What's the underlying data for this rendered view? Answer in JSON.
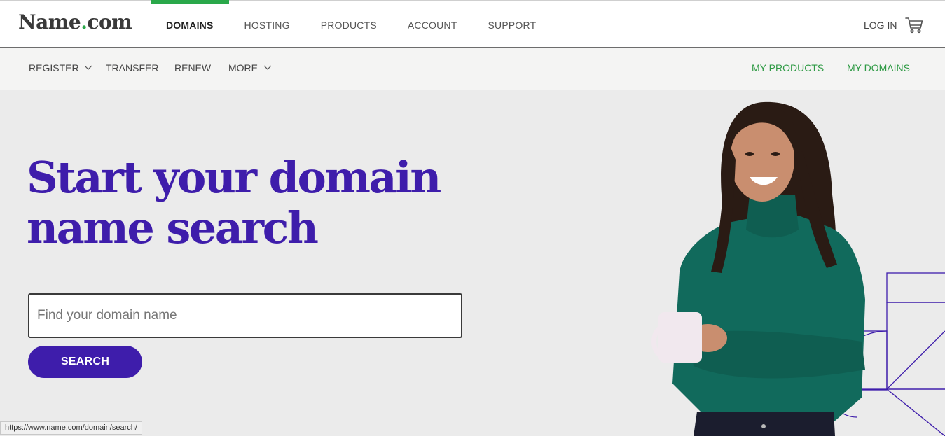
{
  "brand": {
    "name_part": "Name",
    "dot": ".",
    "tld_part": "com",
    "accent": "#2aa84a",
    "primary": "#3e1dab"
  },
  "main_nav": [
    {
      "label": "DOMAINS",
      "active": true
    },
    {
      "label": "HOSTING",
      "active": false
    },
    {
      "label": "PRODUCTS",
      "active": false
    },
    {
      "label": "ACCOUNT",
      "active": false
    },
    {
      "label": "SUPPORT",
      "active": false
    }
  ],
  "header_right": {
    "login_label": "LOG IN",
    "cart_icon": "cart-icon"
  },
  "sub_nav": {
    "left": [
      {
        "label": "REGISTER",
        "has_dropdown": true
      },
      {
        "label": "TRANSFER",
        "has_dropdown": false
      },
      {
        "label": "RENEW",
        "has_dropdown": false
      },
      {
        "label": "MORE",
        "has_dropdown": true
      }
    ],
    "right": [
      {
        "label": "MY PRODUCTS"
      },
      {
        "label": "MY DOMAINS"
      }
    ]
  },
  "hero": {
    "headline_line1": "Start your domain",
    "headline_line2": "name search",
    "search_placeholder": "Find your domain name",
    "search_value": "",
    "search_button": "SEARCH"
  },
  "status_bar": {
    "url": "https://www.name.com/domain/search/"
  }
}
